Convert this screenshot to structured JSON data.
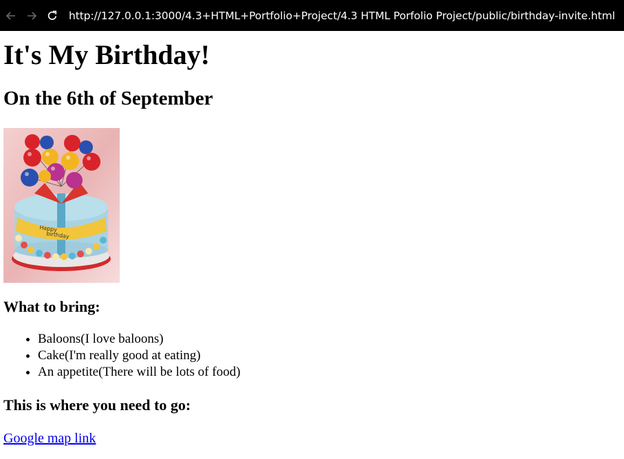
{
  "browser": {
    "url": "http://127.0.0.1:3000/4.3+HTML+Portfolio+Project/4.3 HTML Porfolio Project/public/birthday-invite.html",
    "back_icon": "arrow-left-icon",
    "forward_icon": "arrow-right-icon",
    "reload_icon": "reload-icon"
  },
  "page": {
    "title": "It's My Birthday!",
    "date_heading": "On the 6th of September",
    "image_desc": "birthday-cake-with-balloons",
    "bring_heading": "What to bring:",
    "bring_items": [
      "Baloons(I love baloons)",
      "Cake(I'm really good at eating)",
      "An appetite(There will be lots of food)"
    ],
    "where_heading": "This is where you need to go:",
    "map_link": "Google map link"
  },
  "colors": {
    "topbar": "#000000",
    "link": "#0000ee"
  }
}
